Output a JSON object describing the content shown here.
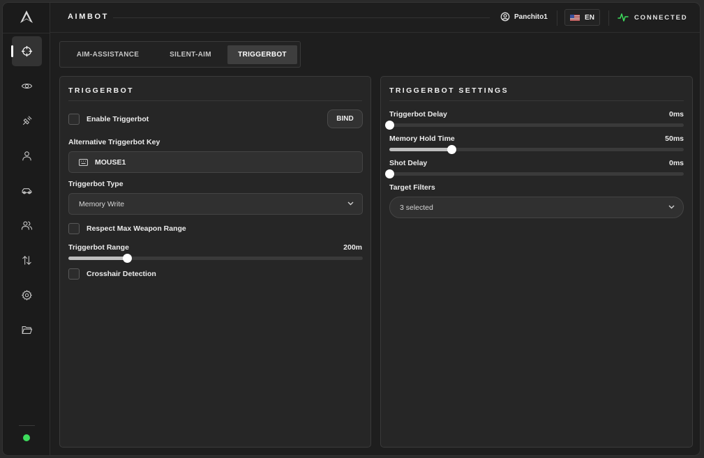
{
  "app": {
    "title": "AIMBOT"
  },
  "header": {
    "username": "Panchito1",
    "language": "EN",
    "connection_status": "CONNECTED",
    "connection_color": "#3ddc5c"
  },
  "sidebar": {
    "items": [
      {
        "name": "crosshair",
        "icon": "crosshair-icon",
        "active": true
      },
      {
        "name": "visuals",
        "icon": "eye-icon",
        "active": false
      },
      {
        "name": "misc",
        "icon": "satellite-icon",
        "active": false
      },
      {
        "name": "player",
        "icon": "user-icon",
        "active": false
      },
      {
        "name": "vehicles",
        "icon": "car-icon",
        "active": false
      },
      {
        "name": "friends",
        "icon": "users-icon",
        "active": false
      },
      {
        "name": "transfer",
        "icon": "arrows-up-down-icon",
        "active": false
      },
      {
        "name": "settings",
        "icon": "gear-icon",
        "active": false
      },
      {
        "name": "configs",
        "icon": "folder-icon",
        "active": false
      }
    ],
    "status_color": "#3ddc5c"
  },
  "tabs": [
    {
      "label": "AIM-ASSISTANCE",
      "active": false
    },
    {
      "label": "SILENT-AIM",
      "active": false
    },
    {
      "label": "TRIGGERBOT",
      "active": true
    }
  ],
  "left_panel": {
    "title": "TRIGGERBOT",
    "enable_label": "Enable Triggerbot",
    "enable_checked": false,
    "bind_label": "BIND",
    "alt_key_label": "Alternative Triggerbot Key",
    "alt_key_value": "MOUSE1",
    "type_label": "Triggerbot Type",
    "type_value": "Memory Write",
    "respect_range_label": "Respect Max Weapon Range",
    "respect_range_checked": false,
    "range_label": "Triggerbot Range",
    "range_value": "200m",
    "range_fraction": 0.2,
    "crosshair_label": "Crosshair Detection",
    "crosshair_checked": false
  },
  "right_panel": {
    "title": "TRIGGERBOT SETTINGS",
    "delay_label": "Triggerbot Delay",
    "delay_value": "0ms",
    "delay_fraction": 0,
    "hold_label": "Memory Hold Time",
    "hold_value": "50ms",
    "hold_fraction": 0.21,
    "shot_label": "Shot Delay",
    "shot_value": "0ms",
    "shot_fraction": 0,
    "filters_label": "Target Filters",
    "filters_value": "3 selected"
  }
}
